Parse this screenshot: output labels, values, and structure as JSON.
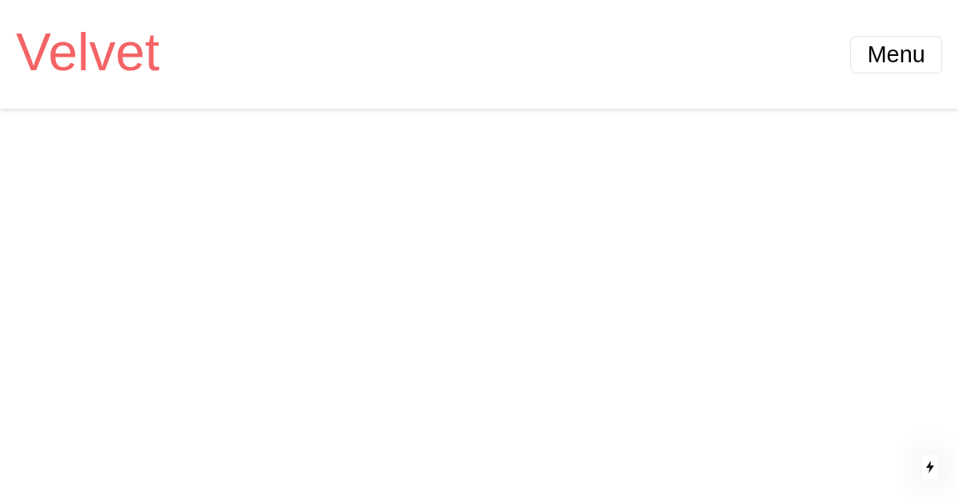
{
  "header": {
    "logo": "Velvet",
    "menu_button": "Menu"
  }
}
